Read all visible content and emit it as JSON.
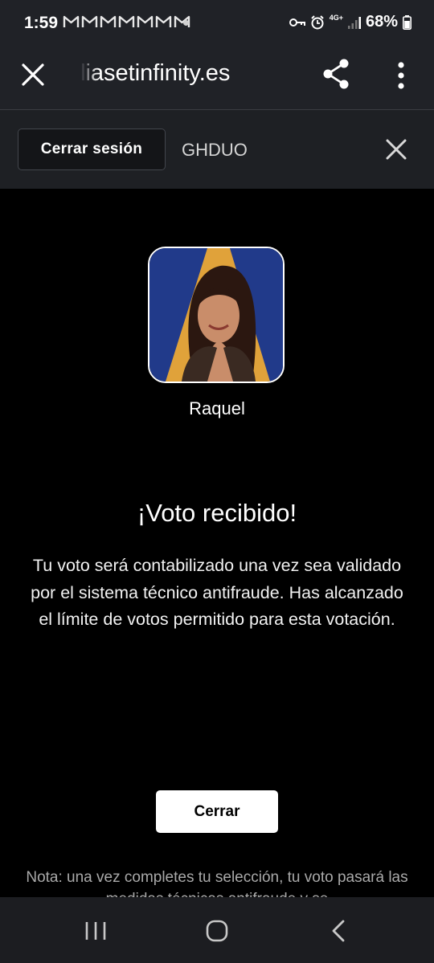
{
  "status_bar": {
    "time": "1:59",
    "notification_icons": [
      "gmail-icon",
      "gmail-icon",
      "gmail-icon",
      "gmail-icon",
      "gmail-icon",
      "gmail-icon",
      "gmail-icon"
    ],
    "network_label": "4G+",
    "battery_percent": "68%"
  },
  "browser_toolbar": {
    "url": "liasetinfinity.es"
  },
  "session_bar": {
    "logout_label": "Cerrar sesión",
    "user_code": "GHDUO"
  },
  "vote": {
    "candidate_name": "Raquel",
    "heading": "¡Voto recibido!",
    "message": "Tu voto será contabilizado una vez sea validado por el sistema técnico antifraude. Has alcanzado el límite de votos permitido para esta votación.",
    "close_label": "Cerrar",
    "note": "Nota: una vez completes tu selección, tu voto pasará las medidas técnicas antifraude y se"
  },
  "colors": {
    "background": "#000000",
    "chrome": "#202227",
    "avatar_backdrop_blue": "#213a8a",
    "avatar_backdrop_gold": "#e0a23a"
  }
}
